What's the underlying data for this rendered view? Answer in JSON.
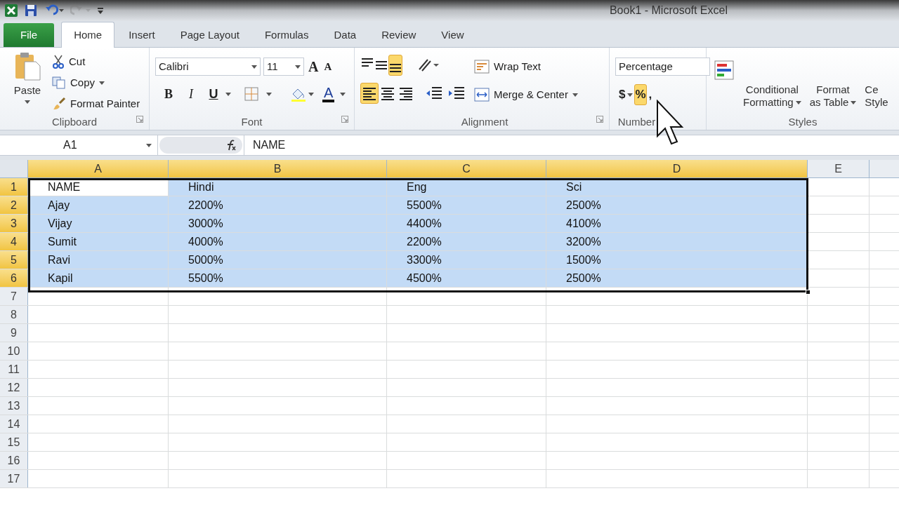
{
  "window": {
    "title": "Book1  -  Microsoft Excel"
  },
  "tabs": [
    {
      "label": "File",
      "selected": false,
      "kind": "file"
    },
    {
      "label": "Home",
      "selected": true,
      "kind": "tab"
    },
    {
      "label": "Insert",
      "selected": false,
      "kind": "tab"
    },
    {
      "label": "Page Layout",
      "selected": false,
      "kind": "tab"
    },
    {
      "label": "Formulas",
      "selected": false,
      "kind": "tab"
    },
    {
      "label": "Data",
      "selected": false,
      "kind": "tab"
    },
    {
      "label": "Review",
      "selected": false,
      "kind": "tab"
    },
    {
      "label": "View",
      "selected": false,
      "kind": "tab"
    }
  ],
  "clipboard": {
    "paste": "Paste",
    "cut": "Cut",
    "copy": "Copy",
    "format_painter": "Format Painter",
    "label": "Clipboard"
  },
  "font": {
    "name": "Calibri",
    "size": "11",
    "grow": "A",
    "shrink": "A",
    "styles": [
      {
        "label": "B",
        "selected": false
      },
      {
        "label": "I",
        "selected": false
      },
      {
        "label": "U",
        "selected": false
      }
    ],
    "color_label": "A",
    "label": "Font"
  },
  "alignment": {
    "vertical": [
      {
        "kind": "top",
        "selected": false
      },
      {
        "kind": "middle",
        "selected": false
      },
      {
        "kind": "bottom",
        "selected": true
      }
    ],
    "horizontal": [
      {
        "kind": "left",
        "selected": true
      },
      {
        "kind": "center",
        "selected": false
      },
      {
        "kind": "right",
        "selected": false
      }
    ],
    "wrap_text": "Wrap Text",
    "merge_center": "Merge & Center",
    "label": "Alignment"
  },
  "number": {
    "format": "Percentage",
    "buttons": [
      {
        "label": "$",
        "selected": false
      },
      {
        "label": "%",
        "selected": true
      },
      {
        "label": ",",
        "selected": false
      }
    ],
    "label": "Number"
  },
  "styles": {
    "conditional": [
      "Conditional",
      "Formatting"
    ],
    "format_table": [
      "Format",
      "as Table"
    ],
    "cell_styles": [
      "Ce",
      "Style"
    ],
    "label": "Styles"
  },
  "formula_bar": {
    "name_box": "A1",
    "formula": "NAME"
  },
  "sheet": {
    "columns": [
      {
        "label": "A",
        "selected": true
      },
      {
        "label": "B",
        "selected": true
      },
      {
        "label": "C",
        "selected": true
      },
      {
        "label": "D",
        "selected": true
      },
      {
        "label": "E",
        "selected": false
      }
    ],
    "rows": [
      {
        "number": "1",
        "selected": true,
        "cells": [
          {
            "text": "NAME",
            "active": true
          },
          {
            "text": "Hindi",
            "active": false
          },
          {
            "text": "Eng",
            "active": false
          },
          {
            "text": "Sci",
            "active": false
          }
        ]
      },
      {
        "number": "2",
        "selected": true,
        "cells": [
          {
            "text": "Ajay",
            "active": false
          },
          {
            "text": "2200%",
            "active": false
          },
          {
            "text": "5500%",
            "active": false
          },
          {
            "text": "2500%",
            "active": false
          }
        ]
      },
      {
        "number": "3",
        "selected": true,
        "cells": [
          {
            "text": "Vijay",
            "active": false
          },
          {
            "text": "3000%",
            "active": false
          },
          {
            "text": "4400%",
            "active": false
          },
          {
            "text": "4100%",
            "active": false
          }
        ]
      },
      {
        "number": "4",
        "selected": true,
        "cells": [
          {
            "text": "Sumit",
            "active": false
          },
          {
            "text": "4000%",
            "active": false
          },
          {
            "text": "2200%",
            "active": false
          },
          {
            "text": "3200%",
            "active": false
          }
        ]
      },
      {
        "number": "5",
        "selected": true,
        "cells": [
          {
            "text": "Ravi",
            "active": false
          },
          {
            "text": "5000%",
            "active": false
          },
          {
            "text": "3300%",
            "active": false
          },
          {
            "text": "1500%",
            "active": false
          }
        ]
      },
      {
        "number": "6",
        "selected": true,
        "cells": [
          {
            "text": "Kapil",
            "active": false
          },
          {
            "text": "5500%",
            "active": false
          },
          {
            "text": "4500%",
            "active": false
          },
          {
            "text": "2500%",
            "active": false
          }
        ]
      },
      {
        "number": "7",
        "selected": false
      },
      {
        "number": "8",
        "selected": false
      },
      {
        "number": "9",
        "selected": false
      },
      {
        "number": "10",
        "selected": false
      },
      {
        "number": "11",
        "selected": false
      },
      {
        "number": "12",
        "selected": false
      },
      {
        "number": "13",
        "selected": false
      },
      {
        "number": "14",
        "selected": false
      },
      {
        "number": "15",
        "selected": false
      },
      {
        "number": "16",
        "selected": false
      },
      {
        "number": "17",
        "selected": false
      }
    ]
  }
}
